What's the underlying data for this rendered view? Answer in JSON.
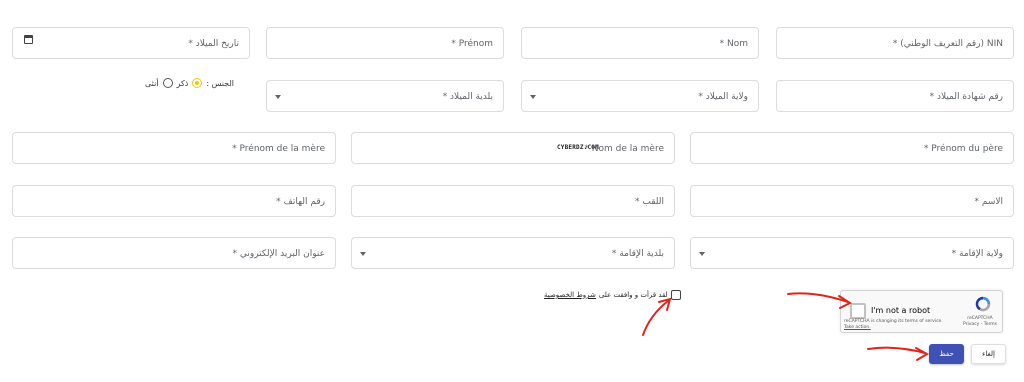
{
  "row1": {
    "nin": "NIN (رقم التعريف الوطني) *",
    "nom": "* Nom",
    "prenom": "* Prénom",
    "birth_date": "تاريخ الميلاد *"
  },
  "row2": {
    "birth_cert": "رقم شهادة الميلاد *",
    "birth_wilaya": "ولاية الميلاد *",
    "birth_commune": "بلدية الميلاد *",
    "gender_label": "الجنس :",
    "gender_male": "ذكر",
    "gender_female": "أنثى"
  },
  "row3": {
    "father_prenom": "* Prénom du père",
    "mother_nom": "* Nom de la mère",
    "mother_prenom": "* Prénom de la mère",
    "watermark": "CYBERDZ.COM"
  },
  "row4": {
    "first_name_ar": "الاسم *",
    "last_name_ar": "اللقب *",
    "phone": "رقم الهاتف *"
  },
  "row5": {
    "res_wilaya": "ولاية الإقامة *",
    "res_commune": "بلدية الإقامة *",
    "email": "عنوان البريد الإلكتروني *"
  },
  "terms": {
    "text": "لقد قرأت و وافقت على",
    "link": "شروط الخصوصية"
  },
  "captcha": {
    "label": "I'm not a robot",
    "notice": "reCAPTCHA is changing its terms of service.",
    "action": "Take action.",
    "brand": "reCAPTCHA",
    "links": "Privacy - Terms"
  },
  "buttons": {
    "save": "حفظ",
    "cancel": "إلغاء"
  },
  "colors": {
    "primary": "#3f51b5",
    "radio_selected": "#f5c30a",
    "annotation": "#e0241b"
  }
}
